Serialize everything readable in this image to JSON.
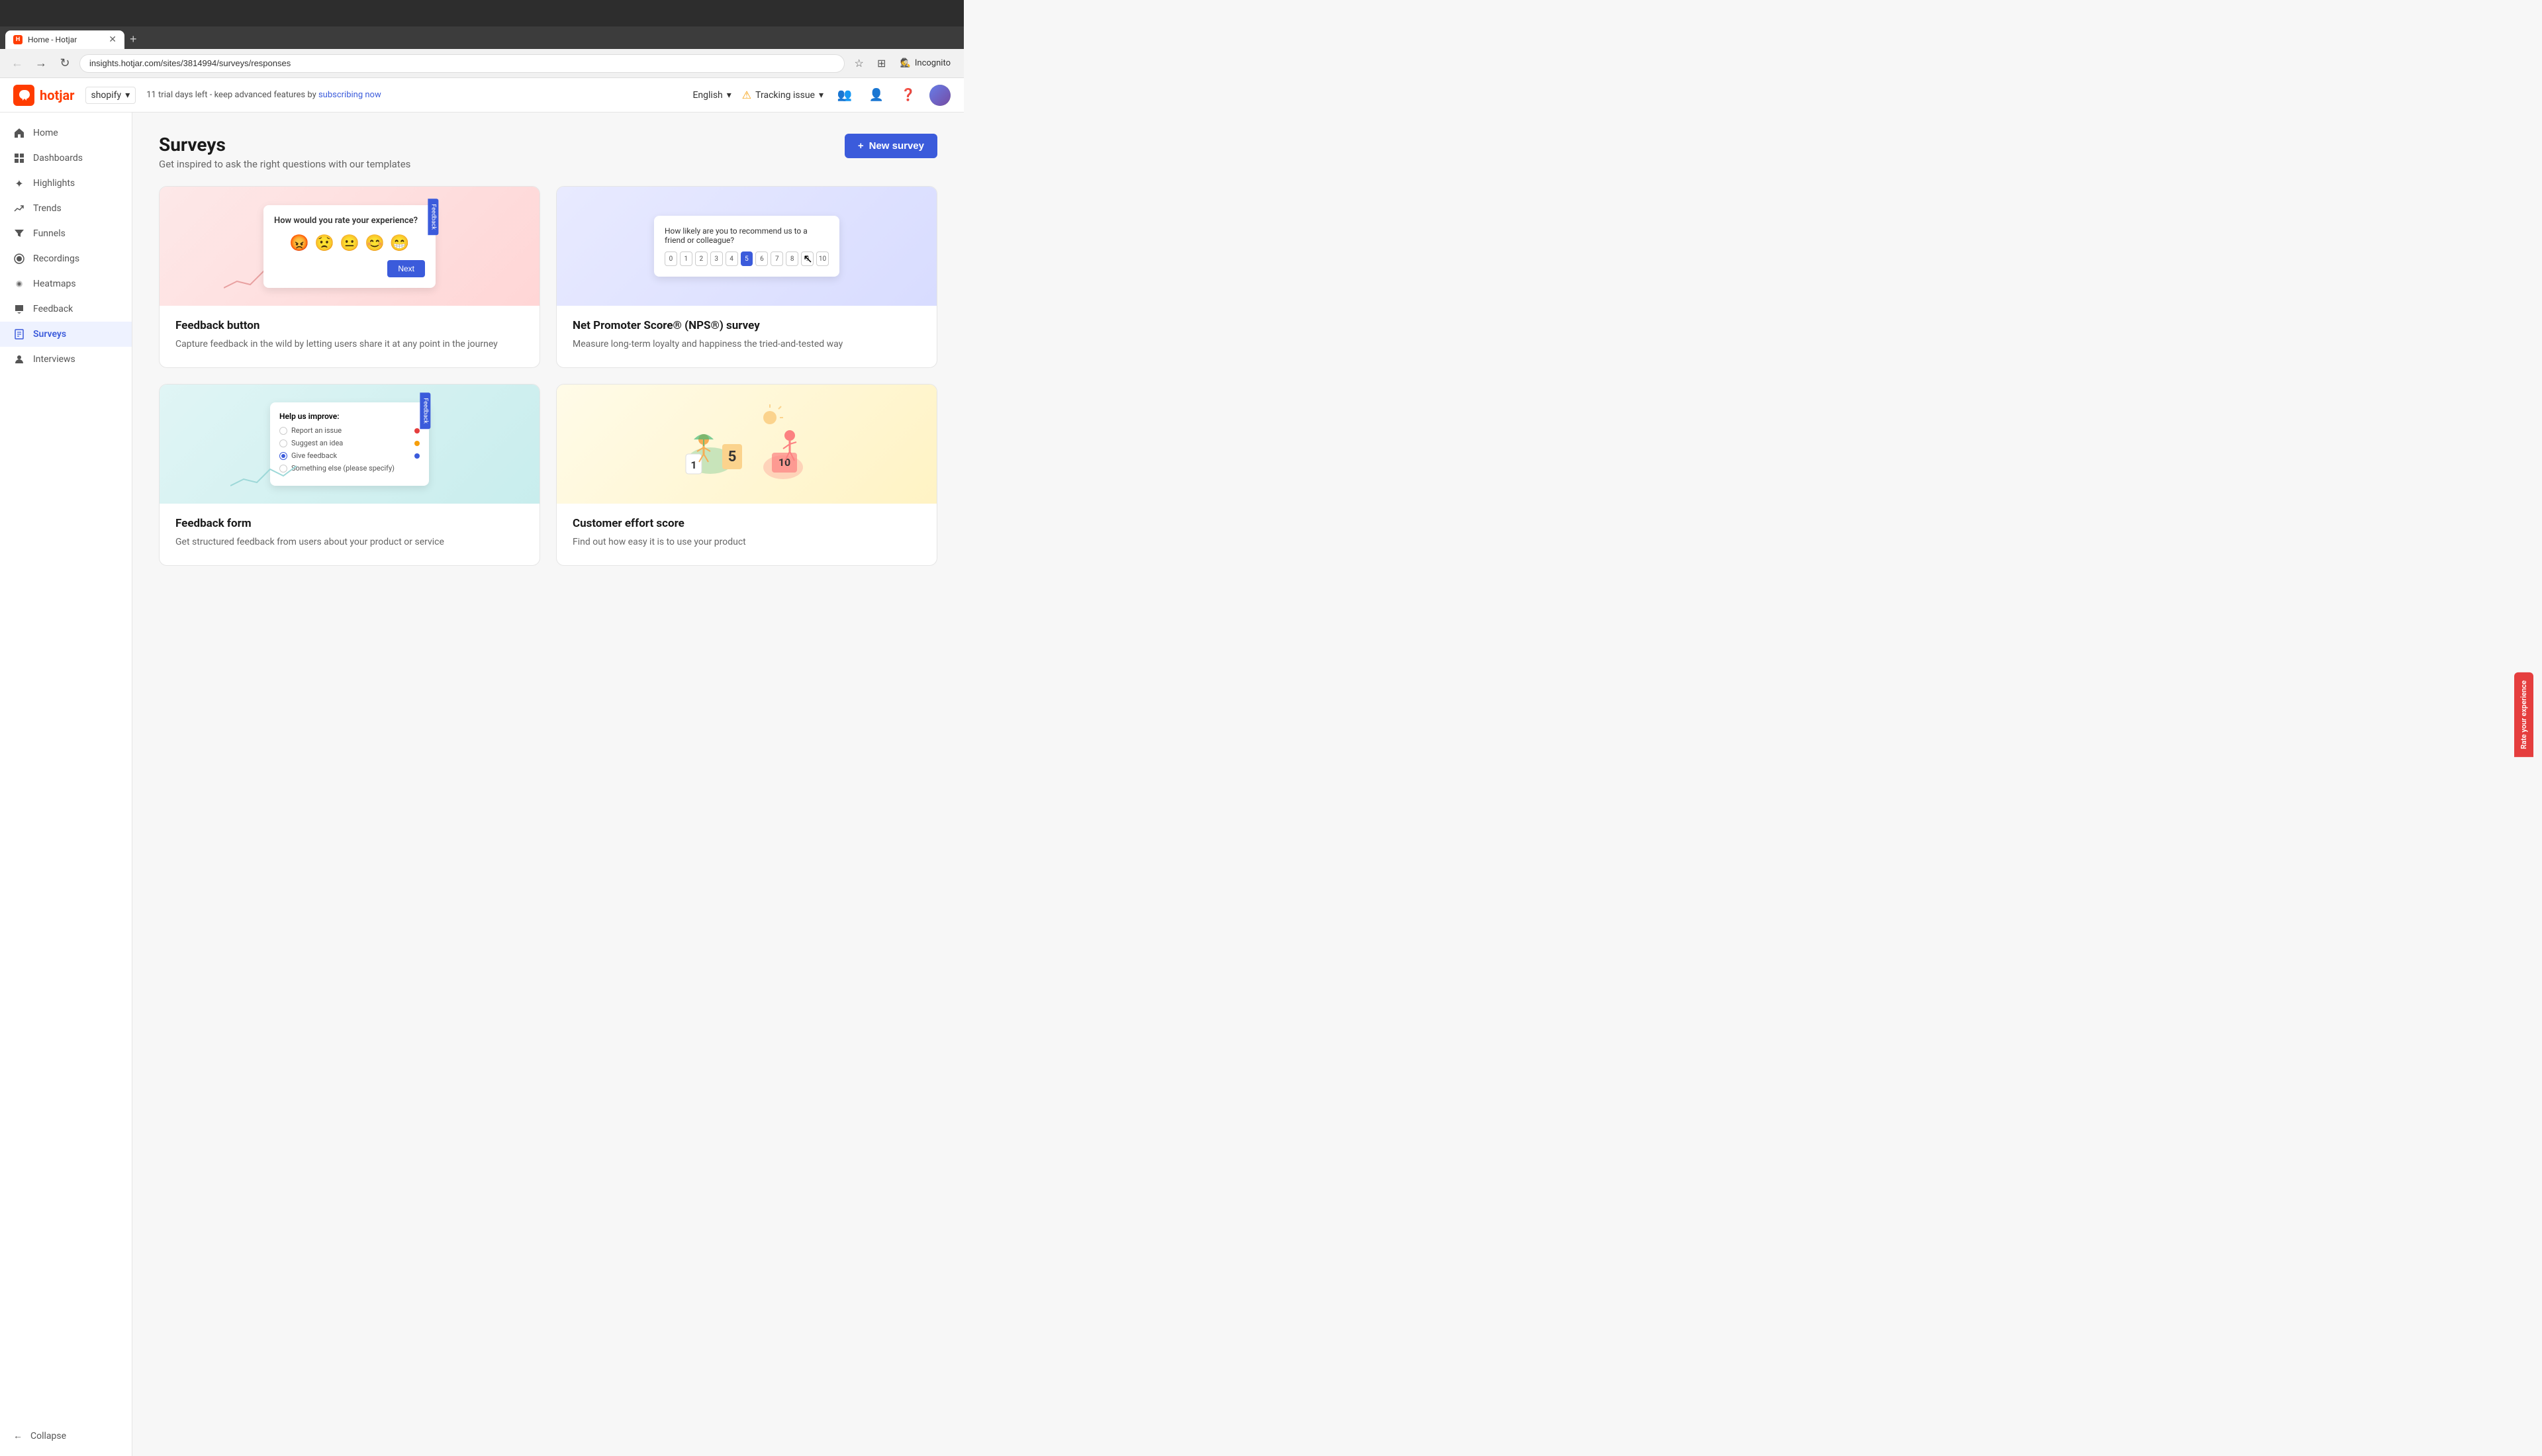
{
  "browser": {
    "tab_title": "Home - Hotjar",
    "url": "insights.hotjar.com/sites/3814994/surveys/responses",
    "tab_new_label": "+",
    "back_btn": "←",
    "forward_btn": "→",
    "refresh_btn": "↻",
    "incognito_label": "Incognito"
  },
  "topbar": {
    "logo_text": "hotjar",
    "site_name": "shopify",
    "trial_text": "11 trial days left - keep advanced features by ",
    "trial_link": "subscribing now",
    "language": "English",
    "tracking_issue": "Tracking issue"
  },
  "sidebar": {
    "items": [
      {
        "id": "home",
        "label": "Home",
        "icon": "🏠"
      },
      {
        "id": "dashboards",
        "label": "Dashboards",
        "icon": "📊"
      },
      {
        "id": "highlights",
        "label": "Highlights",
        "icon": "✨"
      },
      {
        "id": "trends",
        "label": "Trends",
        "icon": "📈"
      },
      {
        "id": "funnels",
        "label": "Funnels",
        "icon": "🔻"
      },
      {
        "id": "recordings",
        "label": "Recordings",
        "icon": "⏺"
      },
      {
        "id": "heatmaps",
        "label": "Heatmaps",
        "icon": "🔥"
      },
      {
        "id": "feedback",
        "label": "Feedback",
        "icon": "💬"
      },
      {
        "id": "surveys",
        "label": "Surveys",
        "icon": "📋",
        "active": true
      },
      {
        "id": "interviews",
        "label": "Interviews",
        "icon": "🎙"
      }
    ],
    "collapse_label": "Collapse"
  },
  "page": {
    "title": "Surveys",
    "subtitle": "Get inspired to ask the right questions with our templates",
    "new_survey_btn": "New survey"
  },
  "cards": [
    {
      "id": "feedback-button",
      "title": "Feedback button",
      "description": "Capture feedback in the wild by letting users share it at any point in the journey",
      "preview_type": "feedback",
      "bg": "pink"
    },
    {
      "id": "nps",
      "title": "Net Promoter Score® (NPS®) survey",
      "description": "Measure long-term loyalty and happiness the tried-and-tested way",
      "preview_type": "nps",
      "bg": "lavender"
    },
    {
      "id": "feedback-form",
      "title": "Feedback form",
      "description": "Get structured feedback from users about your product or service",
      "preview_type": "feedback-form",
      "bg": "teal"
    },
    {
      "id": "ces",
      "title": "Customer effort score",
      "description": "Find out how easy it is to use your product",
      "preview_type": "ces",
      "bg": "yellow"
    }
  ],
  "rate_tab": {
    "label": "Rate your experience"
  },
  "nps_preview": {
    "question": "How likely are you to recommend us to a friend or colleague?",
    "numbers": [
      "0",
      "1",
      "2",
      "3",
      "4",
      "5",
      "6",
      "7",
      "8",
      "9",
      "10"
    ],
    "selected": 5
  },
  "feedback_preview": {
    "question": "How would you rate your experience?",
    "tab_label": "Feedback",
    "next_label": "Next"
  },
  "feedback_form_preview": {
    "title": "Help us improve:",
    "options": [
      {
        "label": "Report an issue",
        "color": "#e53e3e",
        "checked": false
      },
      {
        "label": "Suggest an idea",
        "color": "#f59e0b",
        "checked": false
      },
      {
        "label": "Give feedback",
        "color": "#3b5bdb",
        "checked": true
      },
      {
        "label": "Something else (please specify)",
        "color": "#aaa",
        "checked": false
      }
    ]
  }
}
